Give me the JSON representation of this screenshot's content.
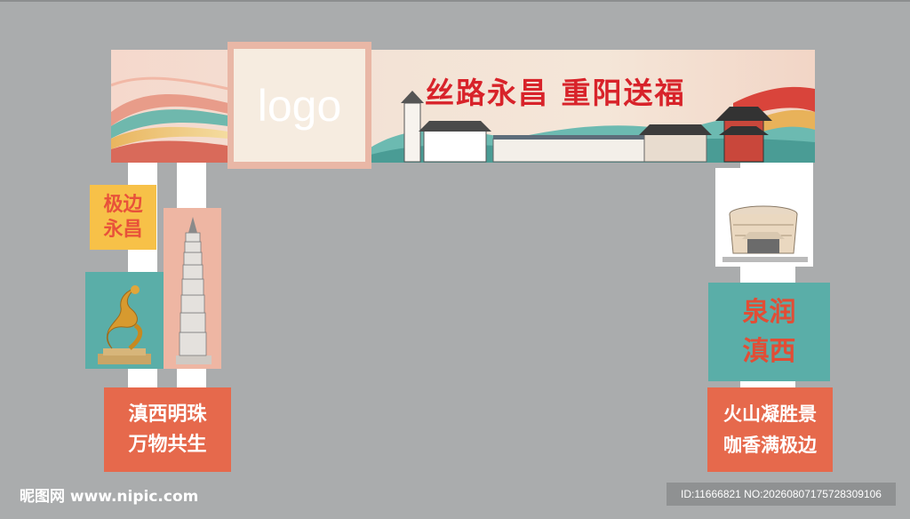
{
  "banner": {
    "logo_text": "logo",
    "slogan": "丝路永昌 重阳送福"
  },
  "left_column": {
    "sign_top_line1": "极边",
    "sign_top_line2": "永昌",
    "sign_bottom_line1": "滇西明珠",
    "sign_bottom_line2": "万物共生",
    "dragon_image": "golden-dragon-statue",
    "pagoda_image": "white-pagoda"
  },
  "right_column": {
    "building_image": "round-museum-building",
    "sign_mid_line1": "泉润",
    "sign_mid_line2": "滇西",
    "sign_bottom_line1": "火山凝胜景",
    "sign_bottom_line2": "咖香满极边"
  },
  "watermark": {
    "site": "昵图网 www.nipic.com",
    "id_text": "ID:11666821 NO:20260807175728309106"
  }
}
